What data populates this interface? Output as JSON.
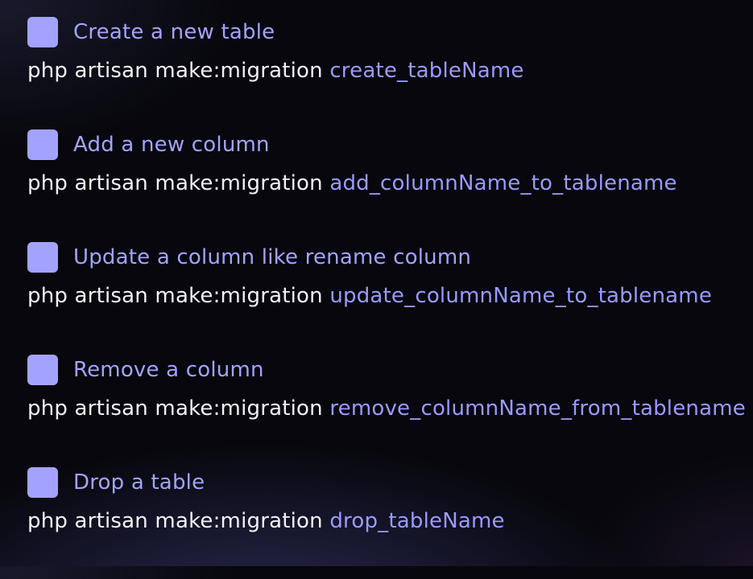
{
  "colors": {
    "accent": "#a3a3ff",
    "command_text": "#f2f2f5",
    "background": "#07070d"
  },
  "items": [
    {
      "title": "Create a new table",
      "command_prefix": "php artisan make:migration ",
      "command_arg": "create_tableName"
    },
    {
      "title": "Add a new column",
      "command_prefix": "php artisan make:migration ",
      "command_arg": "add_columnName_to_tablename"
    },
    {
      "title": "Update a column like rename column",
      "command_prefix": "php artisan make:migration ",
      "command_arg": "update_columnName_to_tablename"
    },
    {
      "title": "Remove a column",
      "command_prefix": "php artisan make:migration ",
      "command_arg": "remove_columnName_from_tablename"
    },
    {
      "title": "Drop a table",
      "command_prefix": "php artisan make:migration ",
      "command_arg": "drop_tableName"
    }
  ]
}
